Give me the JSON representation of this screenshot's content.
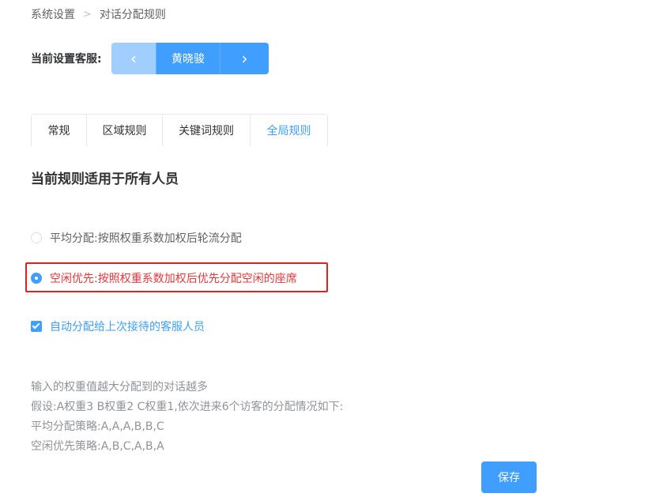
{
  "breadcrumb": {
    "items": [
      "系统设置",
      "对话分配规则"
    ],
    "separator": ">"
  },
  "agent": {
    "label": "当前设置客服:",
    "name": "黄晓骏",
    "prev_icon": "‹",
    "next_icon": "›"
  },
  "tabs": [
    {
      "label": "常规",
      "active": false
    },
    {
      "label": "区域规则",
      "active": false
    },
    {
      "label": "关键词规则",
      "active": false
    },
    {
      "label": "全局规则",
      "active": true
    }
  ],
  "rule_title": "当前规则适用于所有人员",
  "options": [
    {
      "label": "平均分配:按照权重系数加权后轮流分配",
      "checked": false
    },
    {
      "label": "空闲优先:按照权重系数加权后优先分配空闲的座席",
      "checked": true
    }
  ],
  "auto_assign": {
    "label": "自动分配给上次接待的客服人员",
    "checked": true
  },
  "notes": [
    "输入的权重值越大分配到的对话越多",
    "假设:A权重3 B权重2 C权重1,依次进来6个访客的分配情况如下:",
    "平均分配策略:A,A,A,B,B,C",
    "空闲优先策略:A,B,C,A,B,A"
  ],
  "save_label": "保存",
  "colors": {
    "primary": "#409eff",
    "primary_light": "#a0cfff",
    "highlight_border": "#e02020",
    "highlight_text": "#e4393c"
  }
}
